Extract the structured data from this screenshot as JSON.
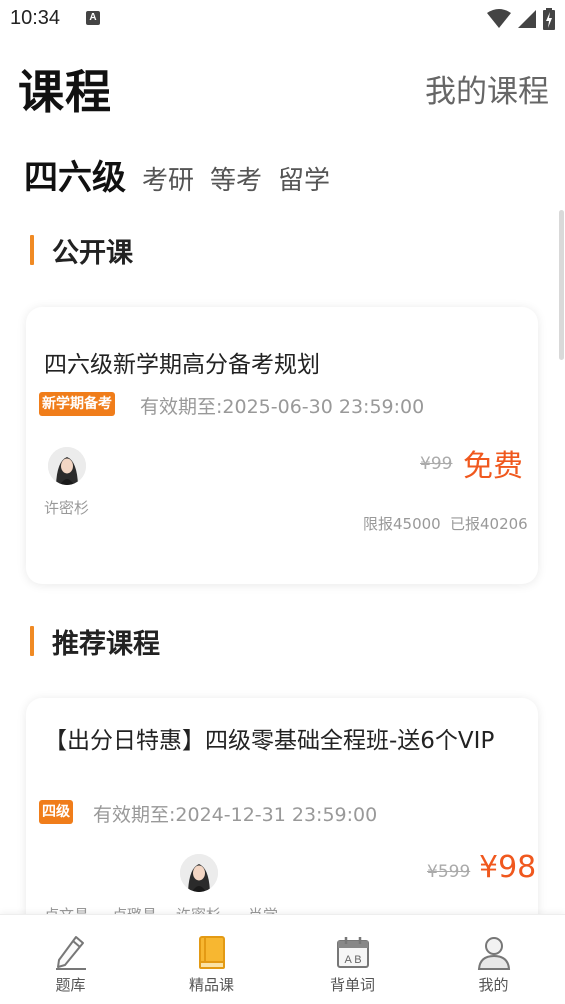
{
  "status_bar": {
    "time": "10:34",
    "notification_icon": "A"
  },
  "header": {
    "title": "课程",
    "my_courses_label": "我的课程"
  },
  "tabs": [
    {
      "label": "四六级",
      "active": true
    },
    {
      "label": "考研",
      "active": false
    },
    {
      "label": "等考",
      "active": false
    },
    {
      "label": "留学",
      "active": false
    }
  ],
  "sections": {
    "public": {
      "title": "公开课",
      "course": {
        "title": "四六级新学期高分备考规划",
        "tag": "新学期备考",
        "validity": "有效期至:2025-06-30 23:59:00",
        "teacher": "许密杉",
        "original_price": "¥99",
        "price": "免费",
        "quota_limit": "限报45000",
        "quota_enrolled": "已报40206"
      }
    },
    "recommended": {
      "title": "推荐课程",
      "course": {
        "title": "【出分日特惠】四级零基础全程班-送6个VIP",
        "tag": "四级",
        "validity": "有效期至:2024-12-31 23:59:00",
        "teacher_names_partial": [
          "卢文昌",
          "卢璐昌",
          "许密杉",
          "肖学"
        ],
        "original_price": "¥599",
        "price": "¥98"
      }
    }
  },
  "bottom_nav": [
    {
      "label": "题库",
      "icon": "pencil-icon",
      "active": false
    },
    {
      "label": "精品课",
      "icon": "book-icon",
      "active": true
    },
    {
      "label": "背单词",
      "icon": "calendar-ab-icon",
      "active": false
    },
    {
      "label": "我的",
      "icon": "person-icon",
      "active": false
    }
  ],
  "colors": {
    "accent": "#f08a24",
    "price": "#f0581e",
    "tag": "#f07d1a",
    "active_nav_icon": "#f5a623"
  }
}
